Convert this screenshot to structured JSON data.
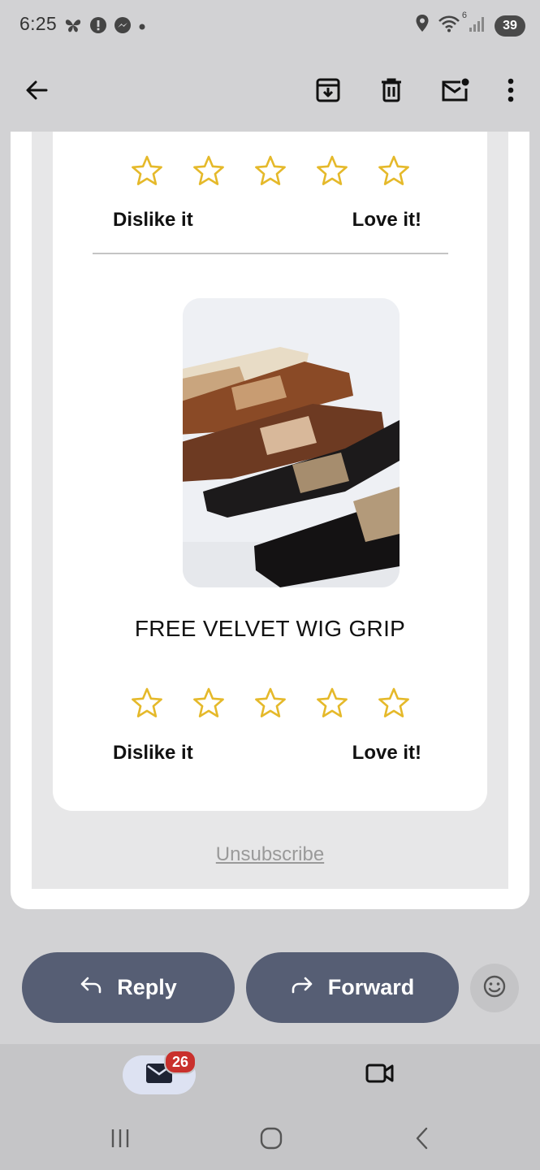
{
  "status_bar": {
    "time": "6:25",
    "wifi_label": "6",
    "battery": "39",
    "icons": [
      "butterfly-icon",
      "alert-icon",
      "messenger-icon",
      "dot-icon",
      "location-icon",
      "wifi-icon",
      "signal-icon"
    ]
  },
  "app_bar": {
    "icons": [
      "back-arrow-icon",
      "archive-icon",
      "delete-icon",
      "mark-unread-icon",
      "more-options-icon"
    ]
  },
  "email": {
    "rating_top": {
      "dislike_label": "Dislike it",
      "love_label": "Love it!"
    },
    "product": {
      "title": "FREE VELVET WIG GRIP"
    },
    "rating_bottom": {
      "dislike_label": "Dislike it",
      "love_label": "Love it!"
    },
    "unsubscribe": "Unsubscribe",
    "star_color": "#e5b92a"
  },
  "actions": {
    "reply_label": "Reply",
    "forward_label": "Forward"
  },
  "bottom_nav": {
    "mail_badge": "26",
    "icons": [
      "mail-icon",
      "video-icon"
    ]
  },
  "colors": {
    "action_button": "#565e74",
    "badge": "#c9302c",
    "star": "#e5b92a"
  }
}
